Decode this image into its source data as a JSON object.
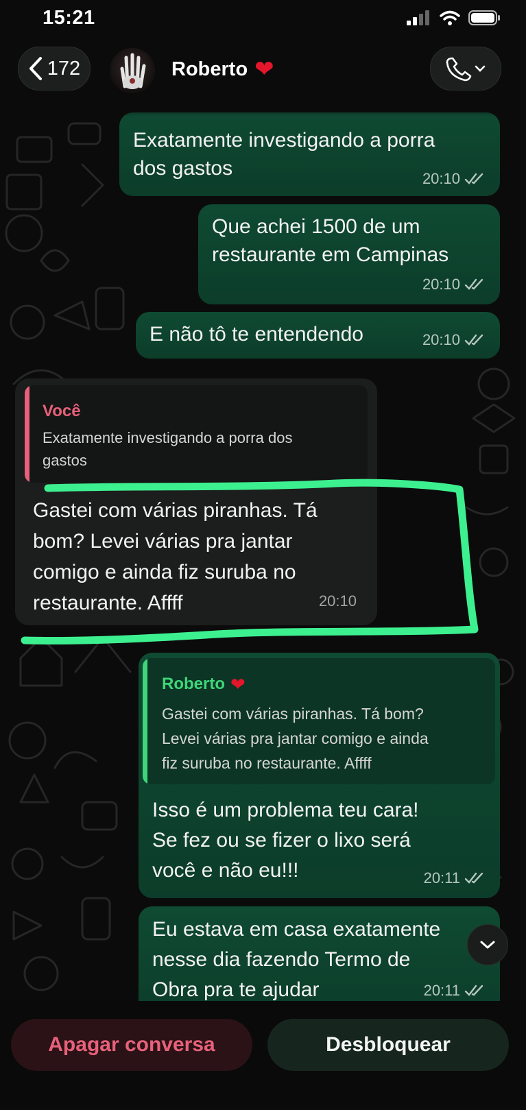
{
  "status_bar": {
    "time": "15:21"
  },
  "header": {
    "back_count": "172",
    "contact_name": "Roberto",
    "contact_emoji": "❤️"
  },
  "messages": [
    {
      "type": "outgoing",
      "lines": [
        "Exatamente investigando a porra",
        "dos gastos"
      ],
      "time": "20:10",
      "ticks": "double-check-icon"
    },
    {
      "type": "outgoing",
      "lines": [
        "Que achei 1500 de um",
        "restaurante em Campinas"
      ],
      "time": "20:10",
      "ticks": "double-check-icon"
    },
    {
      "type": "outgoing",
      "lines": [
        "E não tô te entendendo"
      ],
      "time": "20:10",
      "ticks": "double-check-icon"
    },
    {
      "type": "incoming",
      "quote": {
        "author": "Você",
        "lines": [
          "Exatamente investigando a porra dos",
          "gastos"
        ]
      },
      "lines": [
        "Gastei com várias piranhas. Tá",
        "bom? Levei várias pra jantar",
        "comigo e ainda fiz suruba no",
        "restaurante. Affff"
      ],
      "time": "20:10"
    },
    {
      "type": "outgoing",
      "quote": {
        "author": "Roberto",
        "author_emoji": "❤️",
        "lines": [
          "Gastei com várias piranhas. Tá bom?",
          "Levei várias pra jantar comigo e ainda",
          "fiz suruba no restaurante. Affff"
        ]
      },
      "lines": [
        "Isso é um problema teu cara!",
        "Se fez ou se fizer o lixo será",
        "você e não eu!!!"
      ],
      "time": "20:11",
      "ticks": "double-check-icon"
    },
    {
      "type": "outgoing",
      "lines": [
        "Eu estava em casa exatamente",
        "nesse dia fazendo Termo de",
        "Obra pra te ajudar"
      ],
      "time": "20:11",
      "ticks": "double-check-icon"
    }
  ],
  "bottom_bar": {
    "delete_label": "Apagar conversa",
    "unblock_label": "Desbloquear"
  },
  "colors": {
    "outgoing_bubble": "#0f4a32",
    "incoming_bubble": "#1c1d1d",
    "highlight": "#3df08f",
    "quote_you": "#e7617a",
    "quote_roberto": "#3fd67a"
  }
}
